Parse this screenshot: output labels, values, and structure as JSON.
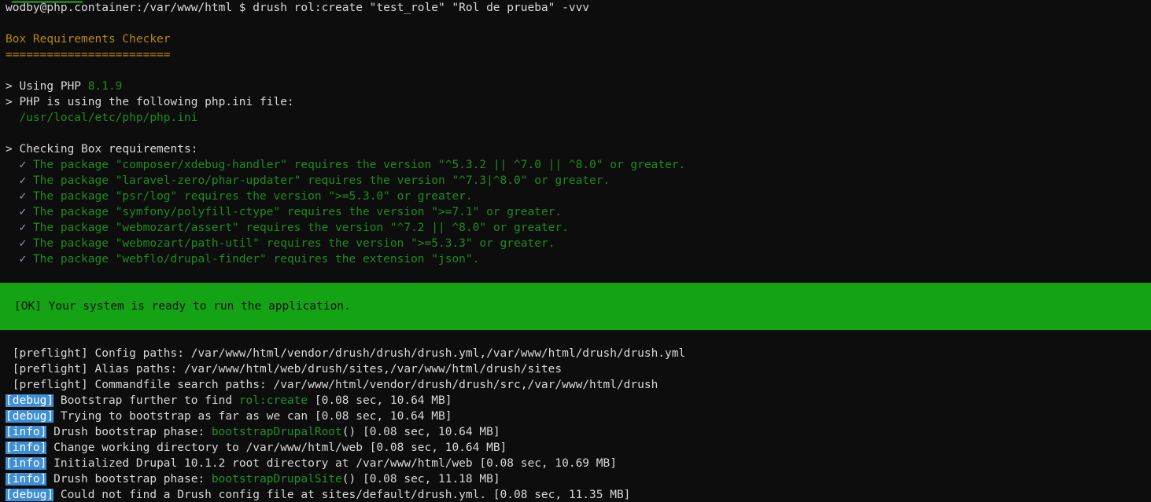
{
  "terminal": {
    "background_color": "#0d0d0d",
    "foreground_color": "#d8d8d8",
    "prompt_line": "wodby@php.container:/var/www/html $ drush rol:create \"test_role\" \"Rol de prueba\" -vvv"
  },
  "box_checker": {
    "title": "Box Requirements Checker",
    "title_color": "#b8860b",
    "underline": "========================",
    "php_line_prefix": "> Using PHP ",
    "php_version": "8.1.9",
    "ini_line": "> PHP is using the following php.ini file:",
    "ini_path": "  /usr/local/etc/php/php.ini",
    "checking_header": "> Checking Box requirements:",
    "check_glyph": "✓",
    "check_glyph_color": "#9d9dc4",
    "requirements": [
      "The package \"composer/xdebug-handler\" requires the version \"^5.3.2 || ^7.0 || ^8.0\" or greater.",
      "The package \"laravel-zero/phar-updater\" requires the version \"^7.3|^8.0\" or greater.",
      "The package \"psr/log\" requires the version \">=5.3.0\" or greater.",
      "The package \"symfony/polyfill-ctype\" requires the version \">=7.1\" or greater.",
      "The package \"webmozart/assert\" requires the version \"^7.2 || ^8.0\" or greater.",
      "The package \"webmozart/path-util\" requires the version \">=5.3.3\" or greater.",
      "The package \"webflo/drupal-finder\" requires the extension \"json\"."
    ]
  },
  "ok_banner": {
    "text": "[OK] Your system is ready to run the application.",
    "background_color": "#14a314",
    "text_color": "#101010"
  },
  "log": {
    "preflight_lines": [
      " [preflight] Config paths: /var/www/html/vendor/drush/drush/drush.yml,/var/www/html/drush/drush.yml",
      " [preflight] Alias paths: /var/www/html/web/drush/sites,/var/www/html/drush/sites",
      " [preflight] Commandfile search paths: /var/www/html/vendor/drush/drush/src,/var/www/html/drush"
    ],
    "tag_background_color": "#3d8fd8",
    "tag_text_color": "#ffffff",
    "entries": [
      {
        "tag": "[debug]",
        "level": "debug",
        "before": " Bootstrap further to find ",
        "highlight": "rol:create",
        "after": " [0.08 sec, 10.64 MB]"
      },
      {
        "tag": "[debug]",
        "level": "debug",
        "before": " Trying to bootstrap as far as we can [0.08 sec, 10.64 MB]",
        "highlight": "",
        "after": ""
      },
      {
        "tag": "[info]",
        "level": "info",
        "before": " Drush bootstrap phase: ",
        "highlight": "bootstrapDrupalRoot",
        "after": "() [0.08 sec, 10.64 MB]"
      },
      {
        "tag": "[info]",
        "level": "info",
        "before": " Change working directory to /var/www/html/web [0.08 sec, 10.64 MB]",
        "highlight": "",
        "after": ""
      },
      {
        "tag": "[info]",
        "level": "info",
        "before": " Initialized Drupal 10.1.2 root directory at /var/www/html/web [0.08 sec, 10.69 MB]",
        "highlight": "",
        "after": ""
      },
      {
        "tag": "[info]",
        "level": "info",
        "before": " Drush bootstrap phase: ",
        "highlight": "bootstrapDrupalSite",
        "after": "() [0.08 sec, 11.18 MB]"
      },
      {
        "tag": "[debug]",
        "level": "debug",
        "before": " Could not find a Drush config file at sites/default/drush.yml. [0.08 sec, 11.35 MB]",
        "highlight": "",
        "after": ""
      }
    ]
  }
}
